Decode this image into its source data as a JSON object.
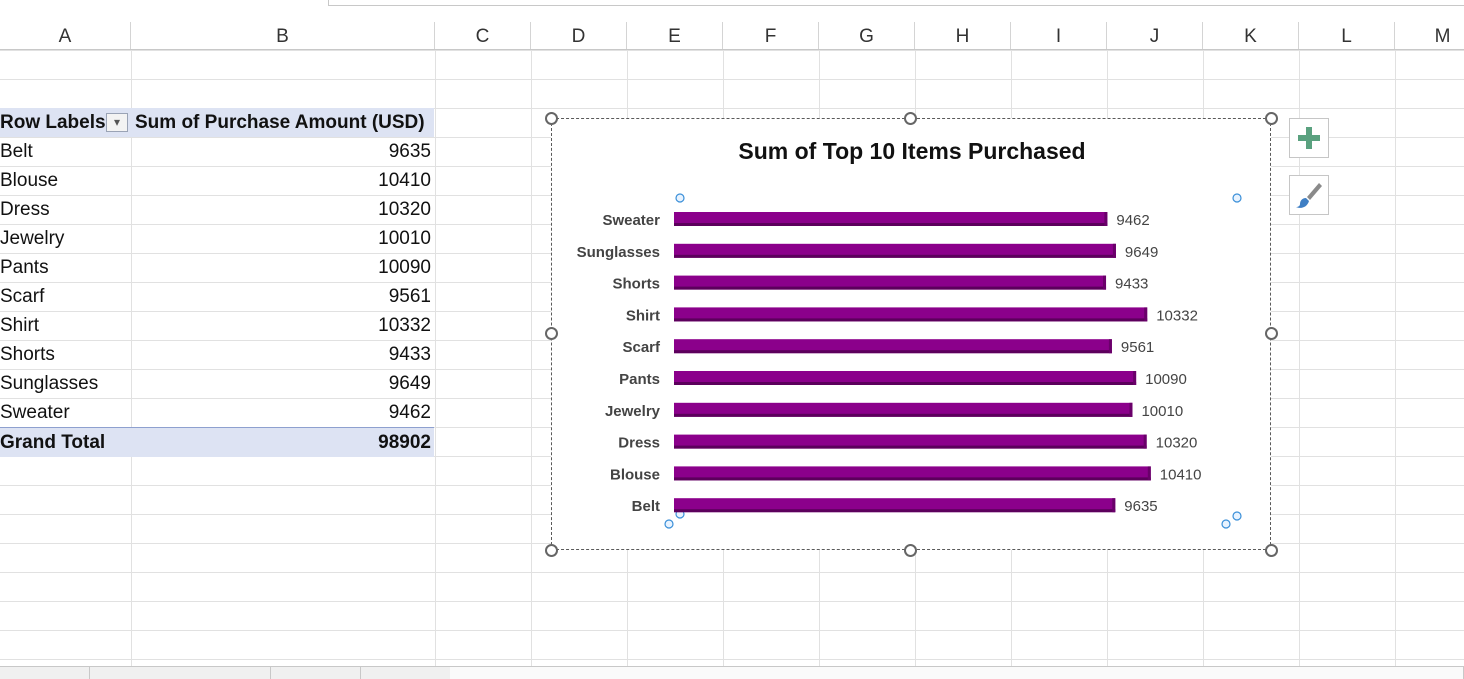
{
  "columns": [
    "A",
    "B",
    "C",
    "D",
    "E",
    "F",
    "G",
    "H",
    "I",
    "J",
    "K",
    "L",
    "M"
  ],
  "pivot": {
    "row_labels_header": "Row Labels",
    "sum_header": "Sum of Purchase Amount (USD)",
    "rows": [
      {
        "label": "Belt",
        "value": "9635"
      },
      {
        "label": "Blouse",
        "value": "10410"
      },
      {
        "label": "Dress",
        "value": "10320"
      },
      {
        "label": "Jewelry",
        "value": "10010"
      },
      {
        "label": "Pants",
        "value": "10090"
      },
      {
        "label": "Scarf",
        "value": "9561"
      },
      {
        "label": "Shirt",
        "value": "10332"
      },
      {
        "label": "Shorts",
        "value": "9433"
      },
      {
        "label": "Sunglasses",
        "value": "9649"
      },
      {
        "label": "Sweater",
        "value": "9462"
      }
    ],
    "grand_total_label": "Grand Total",
    "grand_total_value": "98902"
  },
  "chart_data": {
    "type": "bar",
    "orientation": "horizontal",
    "title": "Sum of Top 10 Items Purchased",
    "categories": [
      "Sweater",
      "Sunglasses",
      "Shorts",
      "Shirt",
      "Scarf",
      "Pants",
      "Jewelry",
      "Dress",
      "Blouse",
      "Belt"
    ],
    "values": [
      9462,
      9649,
      9433,
      10332,
      9561,
      10090,
      10010,
      10320,
      10410,
      9635
    ],
    "data_labels": true,
    "color": "#8b008b",
    "grid": false,
    "legend": "none",
    "xlabel": "",
    "ylabel": ""
  },
  "chart_buttons": {
    "add_element": "plus-icon",
    "style": "brush-icon"
  }
}
